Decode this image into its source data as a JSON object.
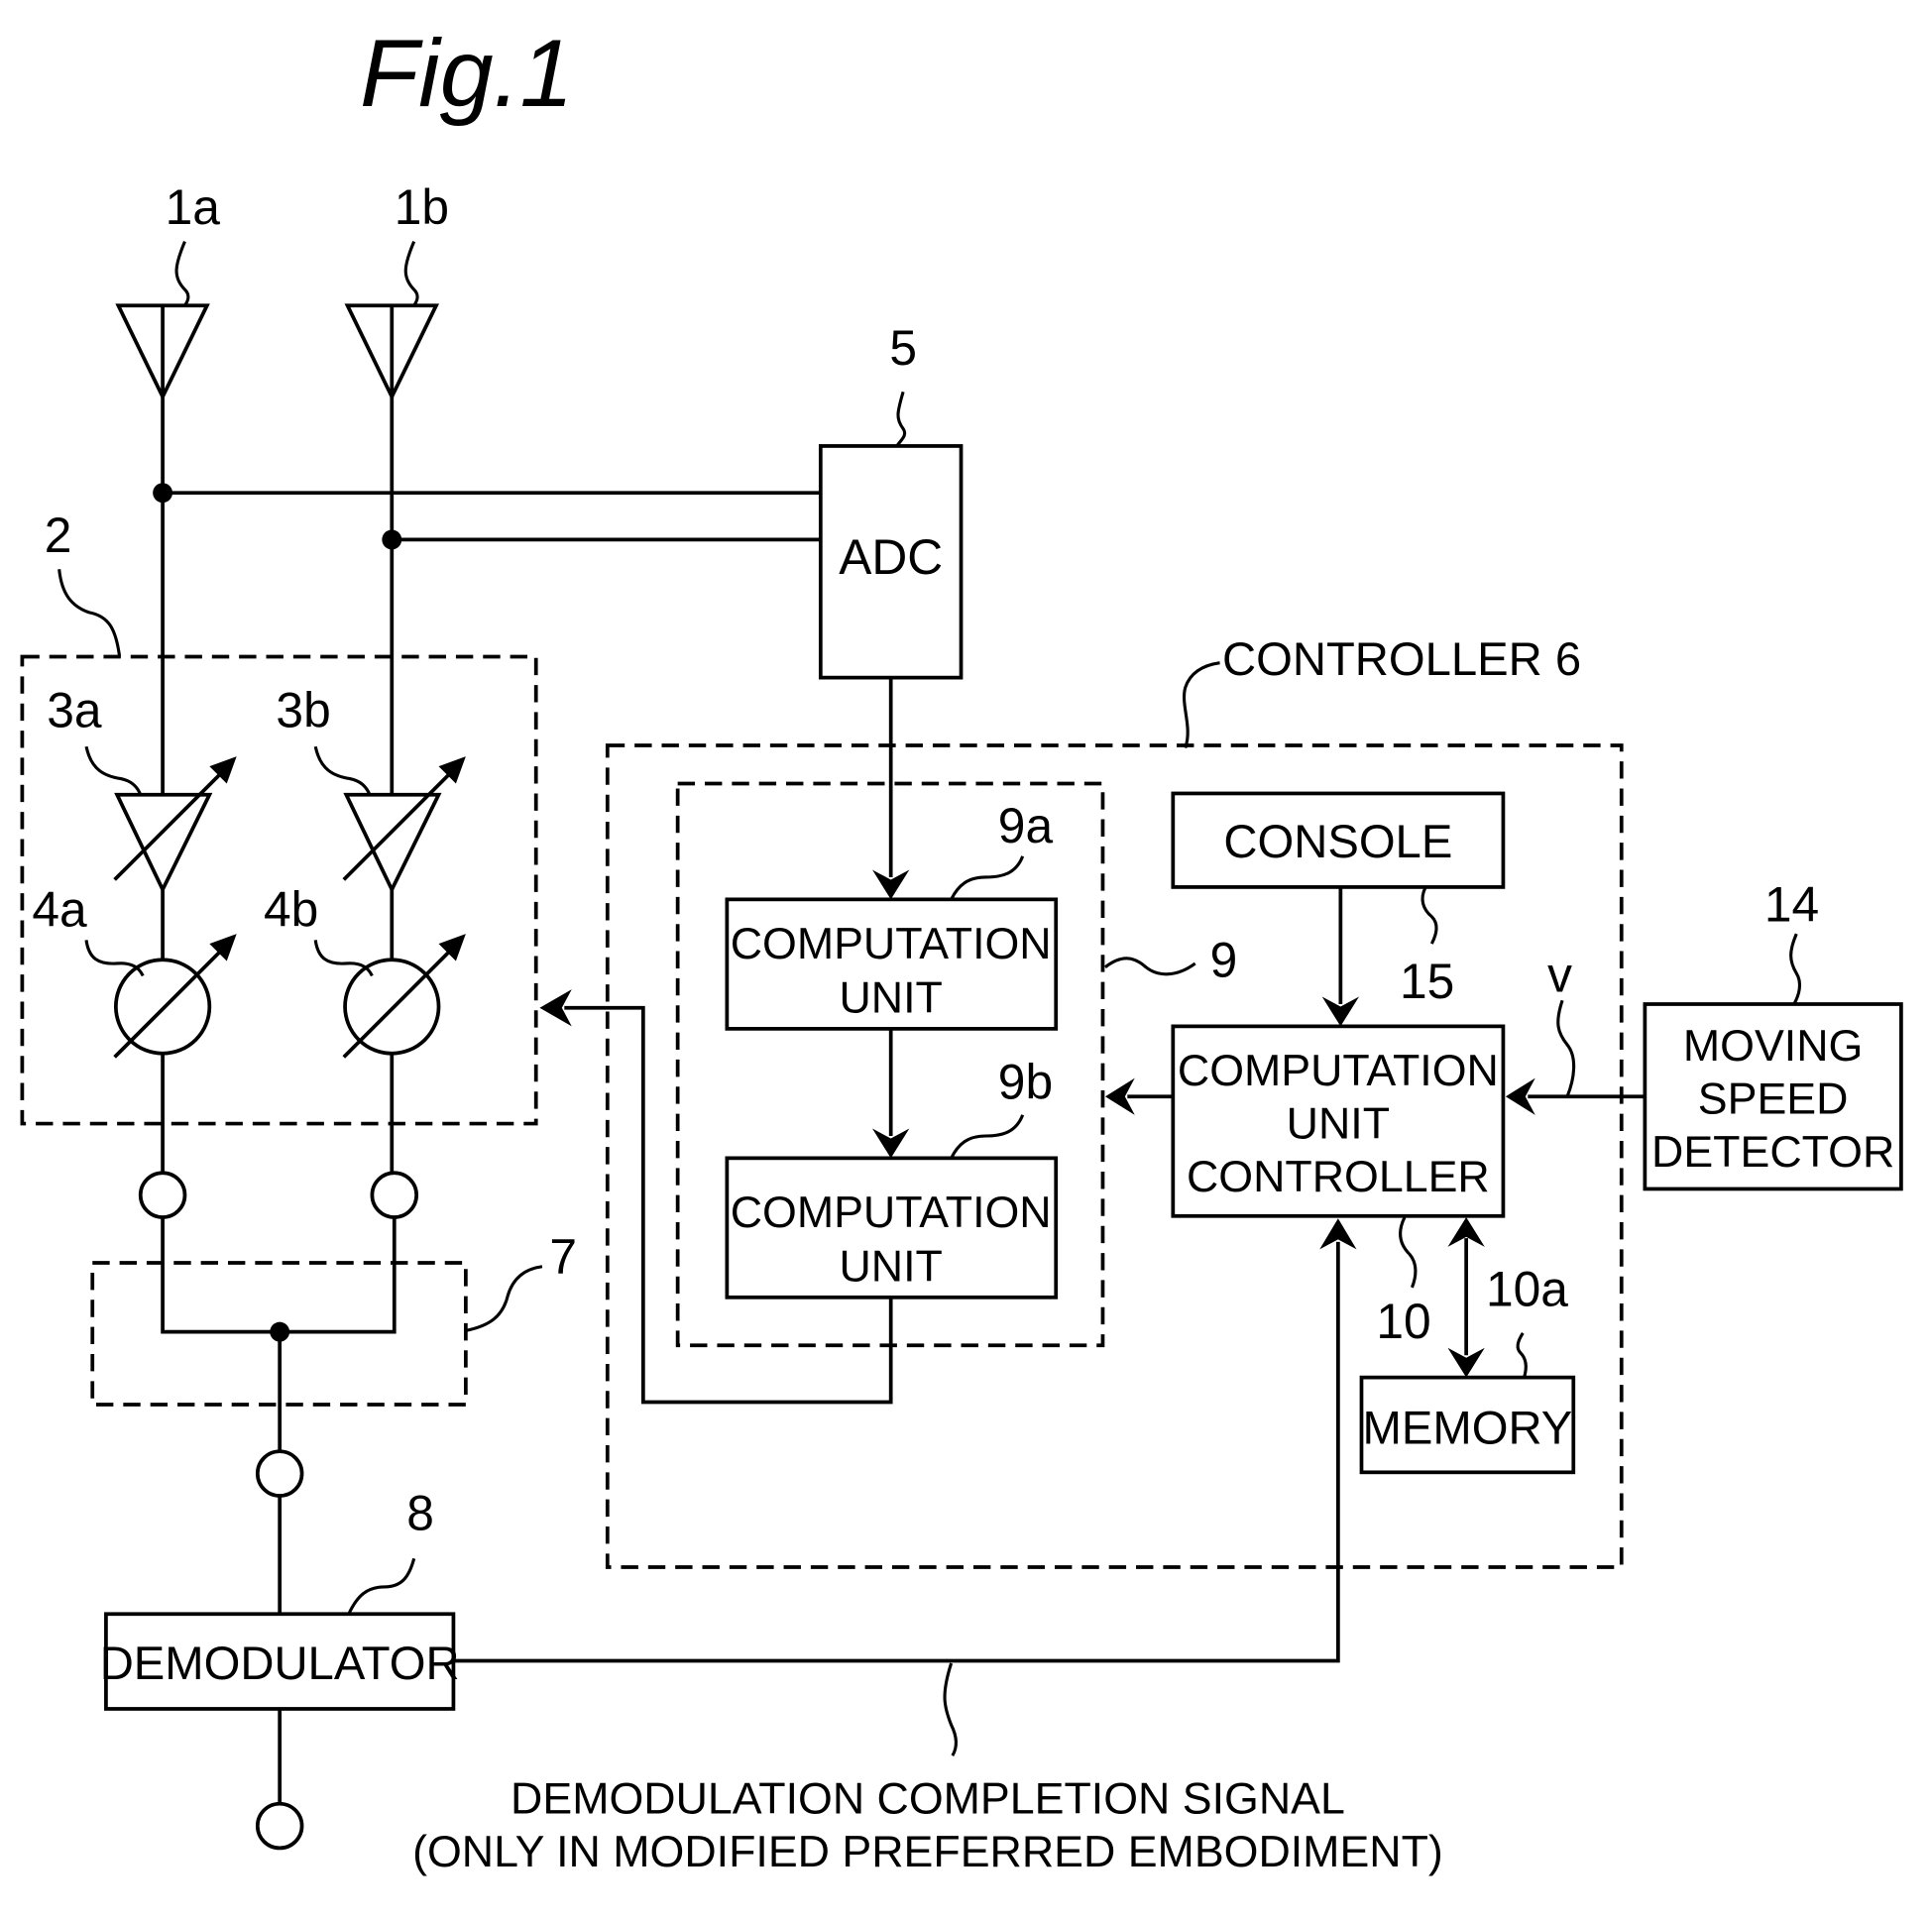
{
  "figure": {
    "title": "Fig.1"
  },
  "blocks": {
    "adc": {
      "label": "ADC",
      "ref": "5"
    },
    "controller": {
      "label": "CONTROLLER  6"
    },
    "computation_unit_a": {
      "lines": [
        "COMPUTATION",
        "UNIT"
      ],
      "ref": "9a"
    },
    "computation_unit_b": {
      "lines": [
        "COMPUTATION",
        "UNIT"
      ],
      "ref": "9b"
    },
    "computation_group": {
      "ref": "9"
    },
    "console": {
      "label": "CONSOLE",
      "ref": "15"
    },
    "computation_unit_controller": {
      "lines": [
        "COMPUTATION",
        "UNIT",
        "CONTROLLER"
      ],
      "ref": "10"
    },
    "memory": {
      "label": "MEMORY",
      "ref": "10a"
    },
    "moving_speed_detector": {
      "lines": [
        "MOVING",
        "SPEED",
        "DETECTOR"
      ],
      "ref": "14"
    },
    "speed_signal": {
      "label": "v"
    },
    "demodulator": {
      "label": "DEMODULATOR",
      "ref": "8"
    },
    "combiner": {
      "ref": "7"
    },
    "weighting_circuit": {
      "ref": "2"
    }
  },
  "antennas": [
    {
      "ref": "1a"
    },
    {
      "ref": "1b"
    }
  ],
  "amplifiers": [
    {
      "ref": "3a"
    },
    {
      "ref": "3b"
    }
  ],
  "phase_shifters": [
    {
      "ref": "4a"
    },
    {
      "ref": "4b"
    }
  ],
  "note": {
    "line1": "DEMODULATION  COMPLETION  SIGNAL",
    "line2": "(ONLY  IN  MODIFIED  PREFERRED  EMBODIMENT)"
  }
}
